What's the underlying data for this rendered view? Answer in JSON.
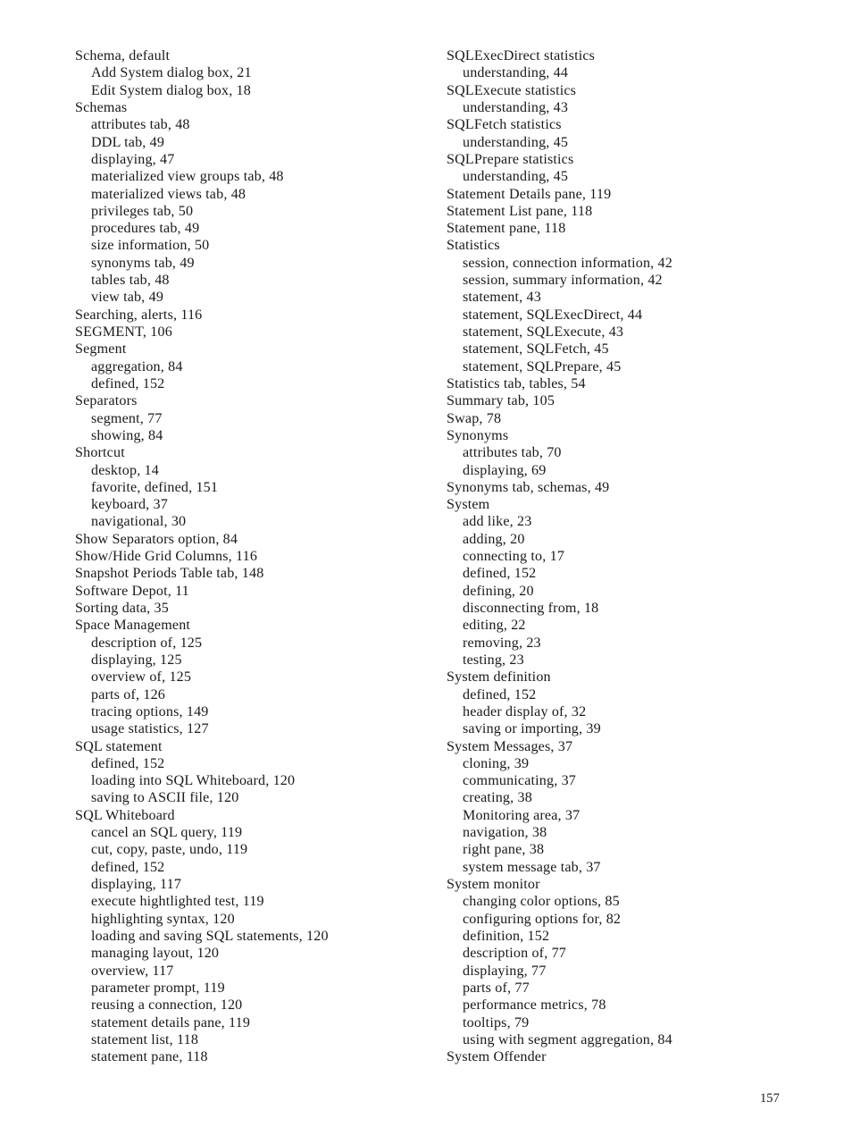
{
  "document": {
    "page_number": "157",
    "columns": [
      {
        "name": "left-column",
        "entries": [
          {
            "text": "Schema, default",
            "level": 0
          },
          {
            "text": "Add System dialog box, 21",
            "level": 1
          },
          {
            "text": "Edit System dialog box, 18",
            "level": 1
          },
          {
            "text": "Schemas",
            "level": 0
          },
          {
            "text": "attributes tab, 48",
            "level": 1
          },
          {
            "text": "DDL tab, 49",
            "level": 1
          },
          {
            "text": "displaying, 47",
            "level": 1
          },
          {
            "text": "materialized view groups tab, 48",
            "level": 1
          },
          {
            "text": "materialized views tab, 48",
            "level": 1
          },
          {
            "text": "privileges tab, 50",
            "level": 1
          },
          {
            "text": "procedures tab, 49",
            "level": 1
          },
          {
            "text": "size information, 50",
            "level": 1
          },
          {
            "text": "synonyms tab, 49",
            "level": 1
          },
          {
            "text": "tables tab, 48",
            "level": 1
          },
          {
            "text": "view tab, 49",
            "level": 1
          },
          {
            "text": "Searching, alerts, 116",
            "level": 0
          },
          {
            "text": "SEGMENT, 106",
            "level": 0
          },
          {
            "text": "Segment",
            "level": 0
          },
          {
            "text": "aggregation, 84",
            "level": 1
          },
          {
            "text": "defined, 152",
            "level": 1
          },
          {
            "text": "Separators",
            "level": 0
          },
          {
            "text": "segment, 77",
            "level": 1
          },
          {
            "text": "showing, 84",
            "level": 1
          },
          {
            "text": "Shortcut",
            "level": 0
          },
          {
            "text": "desktop, 14",
            "level": 1
          },
          {
            "text": "favorite, defined, 151",
            "level": 1
          },
          {
            "text": "keyboard, 37",
            "level": 1
          },
          {
            "text": "navigational, 30",
            "level": 1
          },
          {
            "text": "Show Separators option, 84",
            "level": 0
          },
          {
            "text": "Show/Hide Grid Columns, 116",
            "level": 0
          },
          {
            "text": "Snapshot Periods Table tab, 148",
            "level": 0
          },
          {
            "text": "Software Depot, 11",
            "level": 0
          },
          {
            "text": "Sorting data, 35",
            "level": 0
          },
          {
            "text": "Space Management",
            "level": 0
          },
          {
            "text": "description of, 125",
            "level": 1
          },
          {
            "text": "displaying, 125",
            "level": 1
          },
          {
            "text": "overview of, 125",
            "level": 1
          },
          {
            "text": "parts of, 126",
            "level": 1
          },
          {
            "text": "tracing options, 149",
            "level": 1
          },
          {
            "text": "usage statistics, 127",
            "level": 1
          },
          {
            "text": "SQL statement",
            "level": 0
          },
          {
            "text": "defined, 152",
            "level": 1
          },
          {
            "text": "loading into SQL Whiteboard, 120",
            "level": 1
          },
          {
            "text": "saving to ASCII file, 120",
            "level": 1
          },
          {
            "text": "SQL Whiteboard",
            "level": 0
          },
          {
            "text": "cancel an SQL query, 119",
            "level": 1
          },
          {
            "text": "cut, copy, paste, undo, 119",
            "level": 1
          },
          {
            "text": "defined, 152",
            "level": 1
          },
          {
            "text": "displaying, 117",
            "level": 1
          },
          {
            "text": "execute hightlighted test, 119",
            "level": 1
          },
          {
            "text": "highlighting syntax, 120",
            "level": 1
          },
          {
            "text": "loading and saving SQL statements, 120",
            "level": 1
          },
          {
            "text": "managing layout, 120",
            "level": 1
          },
          {
            "text": "overview, 117",
            "level": 1
          },
          {
            "text": "parameter prompt, 119",
            "level": 1
          },
          {
            "text": "reusing a connection, 120",
            "level": 1
          },
          {
            "text": "statement details pane, 119",
            "level": 1
          },
          {
            "text": "statement list, 118",
            "level": 1
          },
          {
            "text": "statement pane, 118",
            "level": 1
          }
        ]
      },
      {
        "name": "right-column",
        "entries": [
          {
            "text": "SQLExecDirect statistics",
            "level": 0
          },
          {
            "text": "understanding, 44",
            "level": 1
          },
          {
            "text": "SQLExecute statistics",
            "level": 0
          },
          {
            "text": "understanding, 43",
            "level": 1
          },
          {
            "text": "SQLFetch statistics",
            "level": 0
          },
          {
            "text": "understanding, 45",
            "level": 1
          },
          {
            "text": "SQLPrepare statistics",
            "level": 0
          },
          {
            "text": "understanding, 45",
            "level": 1
          },
          {
            "text": "Statement Details pane, 119",
            "level": 0
          },
          {
            "text": "Statement List pane, 118",
            "level": 0
          },
          {
            "text": "Statement pane, 118",
            "level": 0
          },
          {
            "text": "Statistics",
            "level": 0
          },
          {
            "text": "session, connection information, 42",
            "level": 1
          },
          {
            "text": "session, summary information, 42",
            "level": 1
          },
          {
            "text": "statement, 43",
            "level": 1
          },
          {
            "text": "statement, SQLExecDirect, 44",
            "level": 1
          },
          {
            "text": "statement, SQLExecute, 43",
            "level": 1
          },
          {
            "text": "statement, SQLFetch, 45",
            "level": 1
          },
          {
            "text": "statement, SQLPrepare, 45",
            "level": 1
          },
          {
            "text": "Statistics tab, tables, 54",
            "level": 0
          },
          {
            "text": "Summary tab, 105",
            "level": 0
          },
          {
            "text": "Swap, 78",
            "level": 0
          },
          {
            "text": "Synonyms",
            "level": 0
          },
          {
            "text": "attributes tab, 70",
            "level": 1
          },
          {
            "text": "displaying, 69",
            "level": 1
          },
          {
            "text": "Synonyms tab, schemas, 49",
            "level": 0
          },
          {
            "text": "System",
            "level": 0
          },
          {
            "text": "add like, 23",
            "level": 1
          },
          {
            "text": "adding, 20",
            "level": 1
          },
          {
            "text": "connecting to, 17",
            "level": 1
          },
          {
            "text": "defined, 152",
            "level": 1
          },
          {
            "text": "defining, 20",
            "level": 1
          },
          {
            "text": "disconnecting from, 18",
            "level": 1
          },
          {
            "text": "editing, 22",
            "level": 1
          },
          {
            "text": "removing, 23",
            "level": 1
          },
          {
            "text": "testing, 23",
            "level": 1
          },
          {
            "text": "System definition",
            "level": 0
          },
          {
            "text": "defined, 152",
            "level": 1
          },
          {
            "text": "header display of, 32",
            "level": 1
          },
          {
            "text": "saving or importing, 39",
            "level": 1
          },
          {
            "text": "System Messages, 37",
            "level": 0
          },
          {
            "text": "cloning, 39",
            "level": 1
          },
          {
            "text": "communicating, 37",
            "level": 1
          },
          {
            "text": "creating, 38",
            "level": 1
          },
          {
            "text": "Monitoring area, 37",
            "level": 1
          },
          {
            "text": "navigation, 38",
            "level": 1
          },
          {
            "text": "right pane, 38",
            "level": 1
          },
          {
            "text": "system message tab, 37",
            "level": 1
          },
          {
            "text": "System monitor",
            "level": 0
          },
          {
            "text": "changing color options, 85",
            "level": 1
          },
          {
            "text": "configuring options for, 82",
            "level": 1
          },
          {
            "text": "definition, 152",
            "level": 1
          },
          {
            "text": "description of, 77",
            "level": 1
          },
          {
            "text": "displaying, 77",
            "level": 1
          },
          {
            "text": "parts of, 77",
            "level": 1
          },
          {
            "text": "performance metrics, 78",
            "level": 1
          },
          {
            "text": "tooltips, 79",
            "level": 1
          },
          {
            "text": "using with segment aggregation, 84",
            "level": 1
          },
          {
            "text": "System Offender",
            "level": 0
          }
        ]
      }
    ]
  }
}
